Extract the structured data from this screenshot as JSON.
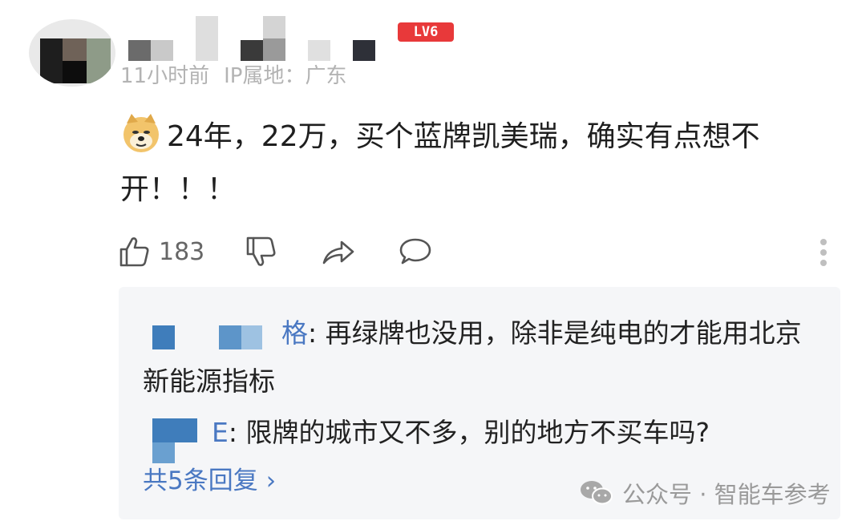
{
  "user": {
    "level_badge": "LV6",
    "time_ago": "11小时前",
    "ip_location": "IP属地：广东"
  },
  "comment": {
    "emoji_icon": "doge-emoji-icon",
    "text": "24年，22万，买个蓝牌凯美瑞，确实有点想不开！！！"
  },
  "actions": {
    "like_count": "183",
    "like_icon": "thumbs-up-icon",
    "dislike_icon": "thumbs-down-icon",
    "share_icon": "share-arrow-icon",
    "reply_icon": "speech-bubble-icon",
    "more_icon": "more-vertical-icon"
  },
  "replies": [
    {
      "author_tail": "格",
      "text": ": 再绿牌也没用，除非是纯电的才能用北京新能源指标"
    },
    {
      "author_tail": "E",
      "text": ": 限牌的城市又不多，别的地方不买车吗?"
    }
  ],
  "more_replies_label": "共5条回复",
  "watermark": {
    "source": "公众号 · 智能车参考",
    "icon": "wechat-icon"
  },
  "colors": {
    "badge": "#e8393a",
    "link": "#4a78c2",
    "reply_bg": "#f5f6f8",
    "meta_text": "#b3b3b3"
  }
}
